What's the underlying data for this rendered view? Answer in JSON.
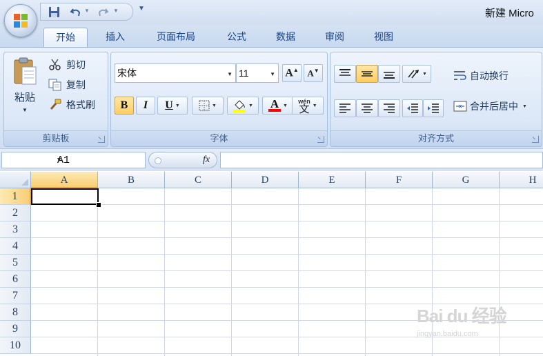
{
  "window": {
    "title": "新建 Micro"
  },
  "ribbon": {
    "tabs": [
      {
        "label": "开始",
        "active": true
      },
      {
        "label": "插入"
      },
      {
        "label": "页面布局"
      },
      {
        "label": "公式"
      },
      {
        "label": "数据"
      },
      {
        "label": "审阅"
      },
      {
        "label": "视图"
      }
    ],
    "clipboard": {
      "label": "剪贴板",
      "paste": "粘贴",
      "cut": "剪切",
      "copy": "复制",
      "format_painter": "格式刷"
    },
    "font": {
      "label": "字体",
      "font_name": "宋体",
      "font_size": "11",
      "bold": "B",
      "italic": "I",
      "underline": "U",
      "font_color_letter": "A",
      "fill_color": "#ffff00",
      "font_color": "#ff0000",
      "phonetic_top": "wén",
      "phonetic_bottom": "文"
    },
    "alignment": {
      "label": "对齐方式",
      "wrap_text": "自动换行",
      "merge_center": "合并后居中"
    }
  },
  "formula_bar": {
    "name_box": "A1",
    "fx_label": "fx",
    "value": ""
  },
  "sheet": {
    "columns": [
      "A",
      "B",
      "C",
      "D",
      "E",
      "F",
      "G",
      "H"
    ],
    "rows": [
      "1",
      "2",
      "3",
      "4",
      "5",
      "6",
      "7",
      "8",
      "9",
      "10"
    ],
    "selected_cell": "A1"
  },
  "watermark": {
    "text": "Bai du 经验",
    "url": "jingyan.baidu.com"
  },
  "colors": {
    "ribbon_bg": "#dbe7f7",
    "tab_text": "#15428b",
    "selection_header": "#f9cf74",
    "gridline": "#d0d7e5"
  }
}
